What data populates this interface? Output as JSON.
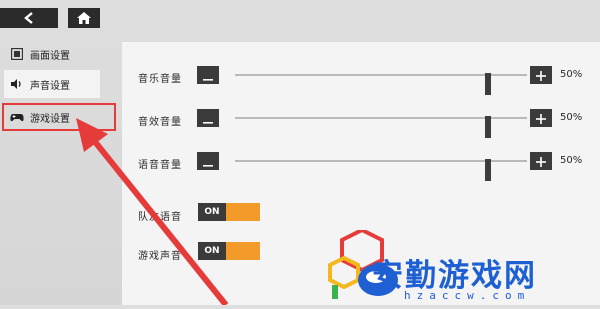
{
  "topbar": {
    "back_icon": "back-arrow-icon",
    "home_icon": "home-icon"
  },
  "sidebar": {
    "items": [
      {
        "label": "画面设置",
        "icon": "display-settings-icon"
      },
      {
        "label": "声音设置",
        "icon": "speaker-icon"
      },
      {
        "label": "游戏设置",
        "icon": "gamepad-icon"
      }
    ],
    "active_index": 1
  },
  "settings": {
    "sliders": [
      {
        "label": "音乐音量",
        "value": "50%",
        "level": 0.5
      },
      {
        "label": "音效音量",
        "value": "50%",
        "level": 0.5
      },
      {
        "label": "语音音量",
        "value": "50%",
        "level": 0.5
      }
    ],
    "toggles": [
      {
        "label": "队友语音",
        "state": "ON"
      },
      {
        "label": "游戏声音",
        "state": "ON"
      }
    ]
  },
  "watermark": {
    "title": "安勤游戏网",
    "url": "hzaccw.com"
  },
  "colors": {
    "accent": "#f29b2b",
    "highlight": "#e53b3b",
    "dark": "#2b2b2b",
    "watermark": "#1e5fd3"
  }
}
